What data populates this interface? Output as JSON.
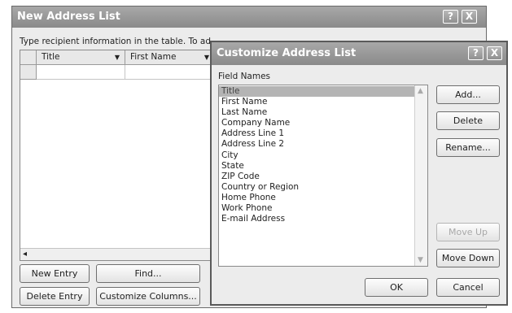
{
  "new_address_list": {
    "title": "New Address List",
    "help_btn": "?",
    "close_btn": "X",
    "instruction": "Type recipient information in the table.  To ad",
    "columns": [
      "Title",
      "First Name"
    ],
    "new_entry": "New Entry",
    "find": "Find...",
    "delete_entry": "Delete Entry",
    "customize_columns": "Customize Columns..."
  },
  "customize": {
    "title": "Customize Address List",
    "help_btn": "?",
    "close_btn": "X",
    "field_names_label": "Field Names",
    "fields": [
      "Title",
      "First Name",
      "Last Name",
      "Company Name",
      "Address Line 1",
      "Address Line 2",
      "City",
      "State",
      "ZIP Code",
      "Country or Region",
      "Home Phone",
      "Work Phone",
      "E-mail Address"
    ],
    "selected_index": 0,
    "add": "Add...",
    "delete": "Delete",
    "rename": "Rename...",
    "move_up": "Move Up",
    "move_down": "Move Down",
    "ok": "OK",
    "cancel": "Cancel"
  }
}
